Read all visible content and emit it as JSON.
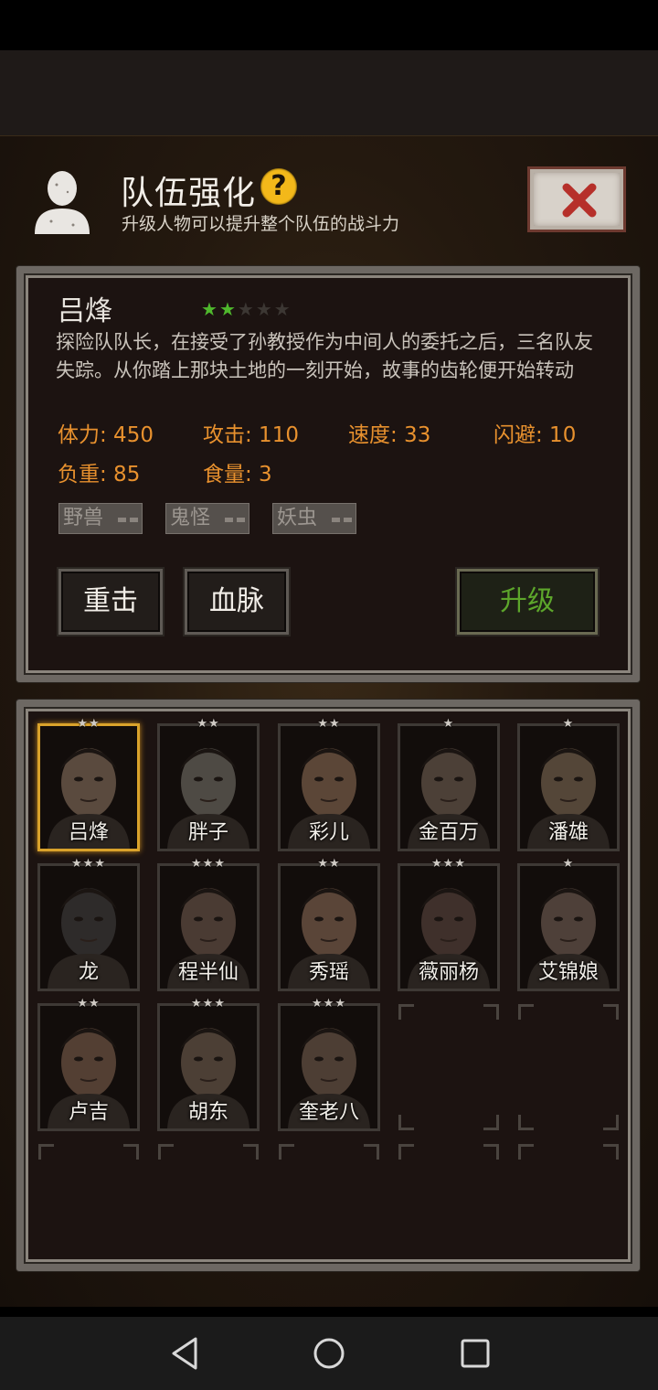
{
  "header": {
    "title": "队伍强化",
    "help_icon": "?",
    "subtitle": "升级人物可以提升整个队伍的战斗力"
  },
  "hero": {
    "name": "吕烽",
    "stars_filled": 2,
    "stars_total": 5,
    "description": "探险队队长，在接受了孙教授作为中间人的委托之后，三名队友失踪。从你踏上那块土地的一刻开始，故事的齿轮便开始转动",
    "stats": {
      "stamina": "体力: 450",
      "attack": "攻击: 110",
      "speed": "速度: 33",
      "dodge": "闪避: 10",
      "load": "负重: 85",
      "food": "食量: 3"
    },
    "tags": [
      "野兽",
      "鬼怪",
      "妖虫"
    ]
  },
  "buttons": {
    "heavy_strike": "重击",
    "bloodline": "血脉",
    "upgrade": "升级"
  },
  "roster": [
    {
      "name": "吕烽",
      "stars": "★★",
      "selected": true
    },
    {
      "name": "胖子",
      "stars": "★★"
    },
    {
      "name": "彩儿",
      "stars": "★★"
    },
    {
      "name": "金百万",
      "stars": "★"
    },
    {
      "name": "潘雄",
      "stars": "★"
    },
    {
      "name": "龙",
      "stars": "★★★"
    },
    {
      "name": "程半仙",
      "stars": "★★★"
    },
    {
      "name": "秀瑶",
      "stars": "★★"
    },
    {
      "name": "薇丽杨",
      "stars": "★★★"
    },
    {
      "name": "艾锦娘",
      "stars": "★"
    },
    {
      "name": "卢吉",
      "stars": "★★"
    },
    {
      "name": "胡东",
      "stars": "★★★"
    },
    {
      "name": "奎老八",
      "stars": "★★★"
    }
  ],
  "colors": {
    "accent_gold": "#d9a22b",
    "star_green": "#4fb82d",
    "stat_orange": "#e8912e",
    "upgrade_green": "#5da62b"
  },
  "icons": {
    "profile": "person-silhouette-icon",
    "close": "red-x-icon",
    "nav_back": "triangle-back-icon",
    "nav_home": "circle-home-icon",
    "nav_recent": "square-recent-icon"
  }
}
